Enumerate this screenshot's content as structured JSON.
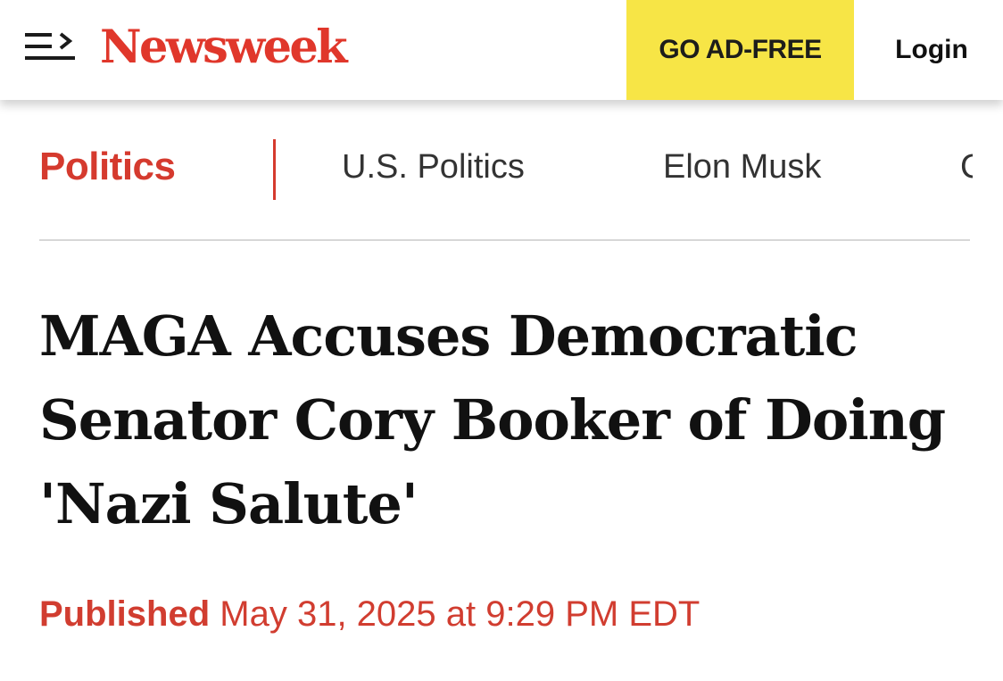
{
  "header": {
    "logo": "Newsweek",
    "ad_free_label": "GO AD-FREE",
    "login_label": "Login",
    "menu_icon": "menu-arrow-icon"
  },
  "nav": {
    "current_section": "Politics",
    "links": [
      "U.S. Politics",
      "Elon Musk",
      "C"
    ]
  },
  "article": {
    "headline": "MAGA Accuses Democratic Senator Cory Booker of Doing 'Nazi Salute'",
    "published_label": "Published",
    "published_date": "May 31, 2025 at 9:29 PM EDT"
  },
  "colors": {
    "brand_red": "#e0372b",
    "ad_yellow": "#f7e546",
    "text_dark": "#111111"
  }
}
